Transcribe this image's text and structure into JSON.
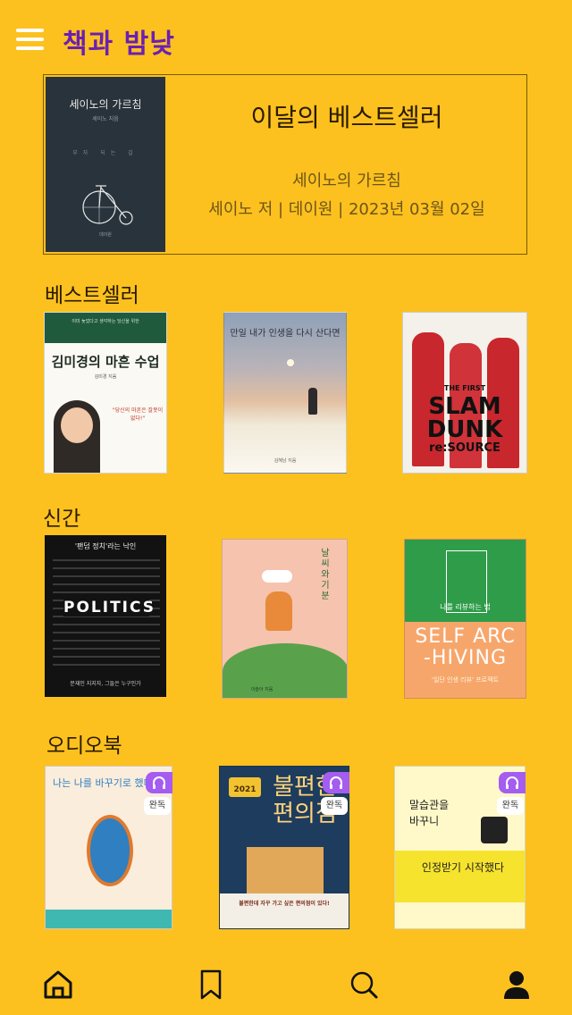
{
  "header": {
    "title": "책과 밤낮"
  },
  "featured": {
    "heading": "이달의 베스트셀러",
    "book_title": "세이노의 가르침",
    "meta": "세이노 저 | 데이원 | 2023년 03월 02일",
    "cover": {
      "title": "세이노의 가르침",
      "author": "세이노 지음",
      "vertical": "부자 되는 길",
      "publisher": "데이원"
    }
  },
  "sections": {
    "bestseller": {
      "title": "베스트셀러",
      "books": [
        {
          "top": "이미 늦었다고 생각하는 당신을 위한",
          "title": "김미경의 마흔 수업",
          "quote": "\"당신의 마흔은 잘못이 없다!\"",
          "sub": "김미경 지음"
        },
        {
          "title": "만일 내가 인생을 다시 산다면",
          "sub": "김혜남 지음"
        },
        {
          "line1": "THE FIRST",
          "line2": "SLAM",
          "line3": "DUNK",
          "line4": "re:SOURCE"
        }
      ]
    },
    "new": {
      "title": "신간",
      "books": [
        {
          "top": "'팬덤 정치'라는 낙인",
          "big": "POLITICS",
          "sub": "문재인 지지자, 그들은 누구인가"
        },
        {
          "title": "날씨와 기분",
          "sub": "이슬아 지음"
        },
        {
          "small": "나를 리뷰하는 법",
          "big1": "SELF ARC",
          "big2": "-HIVING",
          "sub": "'일단 인생 리뷰' 프로젝트"
        }
      ]
    },
    "audiobook": {
      "title": "오디오북",
      "done_label": "완독",
      "books": [
        {
          "title": "나는 나를 바꾸기로 했다"
        },
        {
          "year": "2021",
          "title1": "불편한",
          "title2": "편의점",
          "caption": "불편한데 자꾸 가고 싶은 편의점이 있다!"
        },
        {
          "title1": "말습관을",
          "title2": "바꾸니",
          "title3": "인정받기 시작했다"
        }
      ]
    }
  },
  "tabbar": {
    "items": [
      "home-icon",
      "bookmark-icon",
      "search-icon",
      "user-icon"
    ]
  },
  "colors": {
    "background": "#FCC11F",
    "title": "#6B1FB3",
    "badge": "#A45DF0"
  }
}
